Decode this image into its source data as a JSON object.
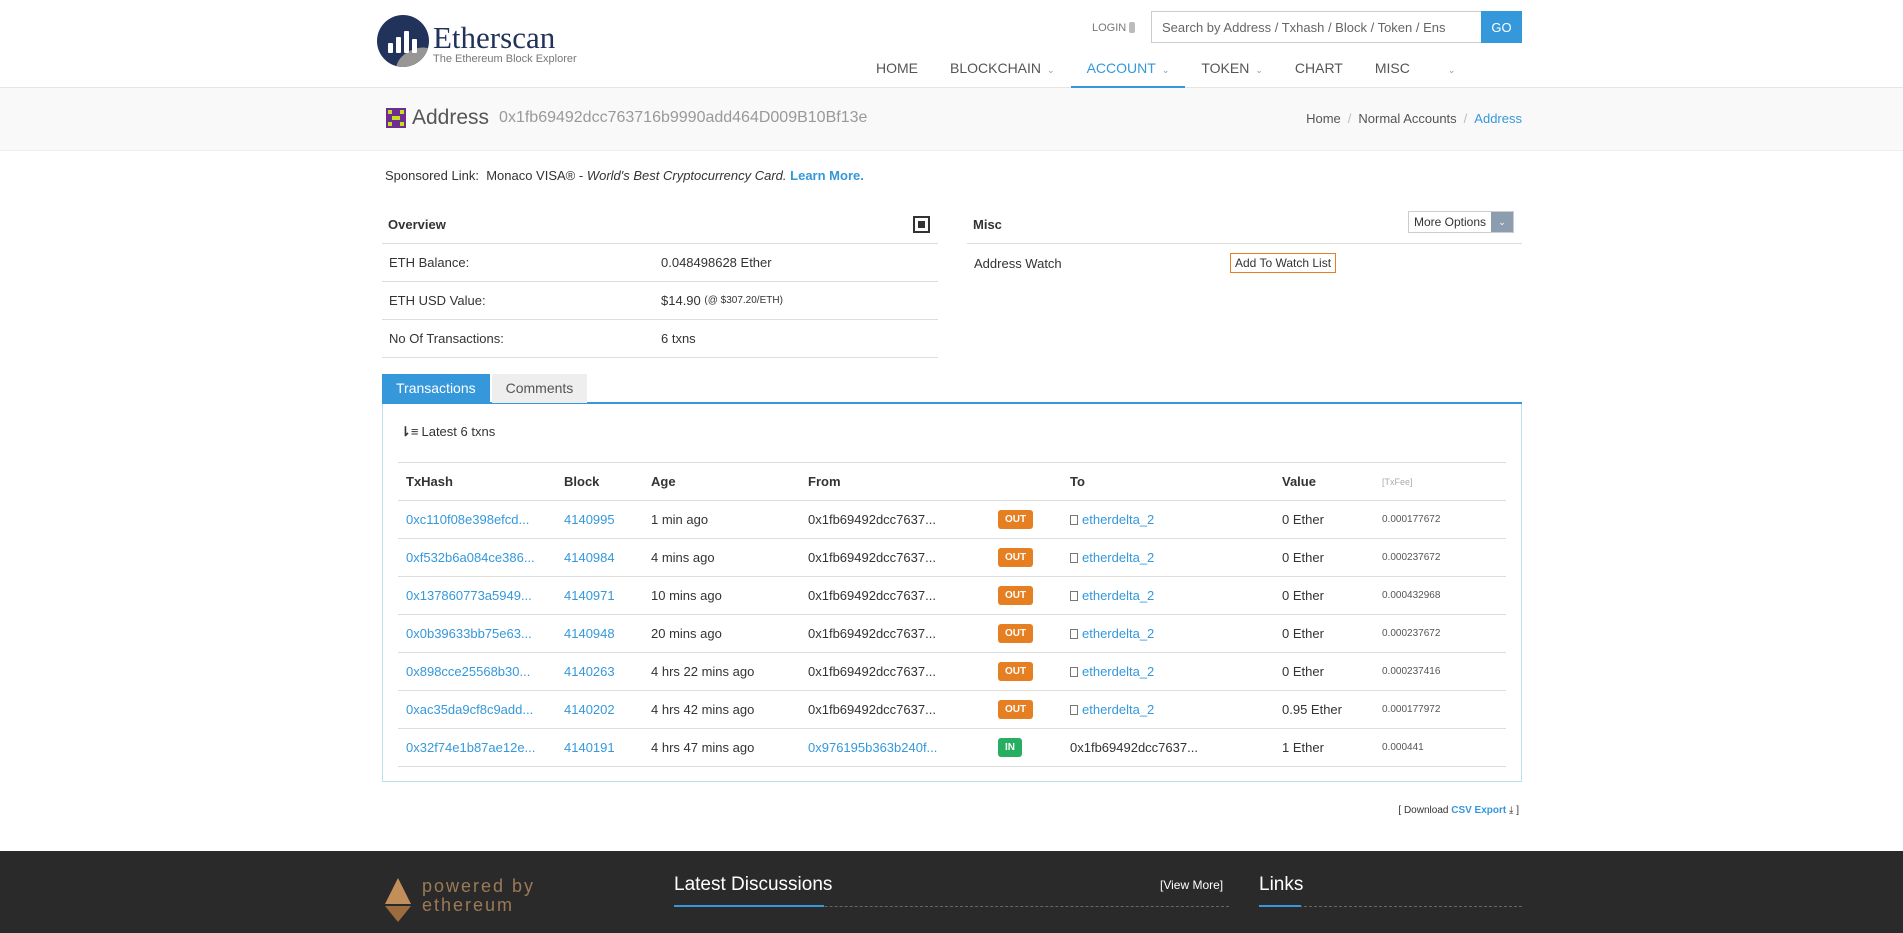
{
  "brand": {
    "name": "Etherscan",
    "tagline": "The Ethereum Block Explorer"
  },
  "header": {
    "login_label": "LOGIN",
    "search_placeholder": "Search by Address / Txhash / Block / Token / Ens",
    "search_button": "GO",
    "nav": [
      {
        "label": "HOME",
        "chevron": false,
        "active": false
      },
      {
        "label": "BLOCKCHAIN",
        "chevron": true,
        "active": false
      },
      {
        "label": "ACCOUNT",
        "chevron": true,
        "active": true
      },
      {
        "label": "TOKEN",
        "chevron": true,
        "active": false
      },
      {
        "label": "CHART",
        "chevron": false,
        "active": false
      },
      {
        "label": "MISC",
        "chevron": false,
        "active": false
      }
    ],
    "nav_extra_chevron": "⌄"
  },
  "page": {
    "title": "Address",
    "address": "0x1fb69492dcc763716b9990add464D009B10Bf13e",
    "breadcrumb": [
      "Home",
      "Normal Accounts",
      "Address"
    ]
  },
  "sponsor": {
    "prefix": "Sponsored Link:",
    "name": "Monaco VISA® - ",
    "tagline": "World's Best Cryptocurrency Card.",
    "cta": "Learn More."
  },
  "overview": {
    "title": "Overview",
    "balance_label": "ETH Balance:",
    "balance_value": "0.048498628 Ether",
    "usd_label": "ETH USD Value:",
    "usd_value": "$14.90",
    "usd_rate": "(@ $307.20/ETH)",
    "txcount_label": "No Of Transactions:",
    "txcount_value": "6 txns"
  },
  "misc": {
    "title": "Misc",
    "more_options": "More Options",
    "watch_label": "Address Watch",
    "watch_button": "Add To Watch List"
  },
  "tabs": [
    "Transactions",
    "Comments"
  ],
  "transactions": {
    "summary": "Latest 6 txns",
    "columns": [
      "TxHash",
      "Block",
      "Age",
      "From",
      "",
      "To",
      "Value",
      "[TxFee]"
    ],
    "rows": [
      {
        "hash": "0xc110f08e398efcd...",
        "block": "4140995",
        "age": "1 min ago",
        "from": "0x1fb69492dcc7637...",
        "from_link": false,
        "dir": "OUT",
        "to": "etherdelta_2",
        "to_contract": true,
        "value": "0 Ether",
        "fee": "0.000177672"
      },
      {
        "hash": "0xf532b6a084ce386...",
        "block": "4140984",
        "age": "4 mins ago",
        "from": "0x1fb69492dcc7637...",
        "from_link": false,
        "dir": "OUT",
        "to": "etherdelta_2",
        "to_contract": true,
        "value": "0 Ether",
        "fee": "0.000237672"
      },
      {
        "hash": "0x137860773a5949...",
        "block": "4140971",
        "age": "10 mins ago",
        "from": "0x1fb69492dcc7637...",
        "from_link": false,
        "dir": "OUT",
        "to": "etherdelta_2",
        "to_contract": true,
        "value": "0 Ether",
        "fee": "0.000432968"
      },
      {
        "hash": "0x0b39633bb75e63...",
        "block": "4140948",
        "age": "20 mins ago",
        "from": "0x1fb69492dcc7637...",
        "from_link": false,
        "dir": "OUT",
        "to": "etherdelta_2",
        "to_contract": true,
        "value": "0 Ether",
        "fee": "0.000237672"
      },
      {
        "hash": "0x898cce25568b30...",
        "block": "4140263",
        "age": "4 hrs 22 mins ago",
        "from": "0x1fb69492dcc7637...",
        "from_link": false,
        "dir": "OUT",
        "to": "etherdelta_2",
        "to_contract": true,
        "value": "0 Ether",
        "fee": "0.000237416"
      },
      {
        "hash": "0xac35da9cf8c9add...",
        "block": "4140202",
        "age": "4 hrs 42 mins ago",
        "from": "0x1fb69492dcc7637...",
        "from_link": false,
        "dir": "OUT",
        "to": "etherdelta_2",
        "to_contract": true,
        "value": "0.95 Ether",
        "fee": "0.000177972"
      },
      {
        "hash": "0x32f74e1b87ae12e...",
        "block": "4140191",
        "age": "4 hrs 47 mins ago",
        "from": "0x976195b363b240f...",
        "from_link": true,
        "dir": "IN",
        "to": "0x1fb69492dcc7637...",
        "to_contract": false,
        "value": "1 Ether",
        "fee": "0.000441"
      }
    ]
  },
  "csv": {
    "prefix": "[ Download ",
    "link": "CSV Export",
    "suffix": " ]"
  },
  "footer": {
    "powered_line1": "powered by",
    "powered_line2": "ethereum",
    "discussions_title": "Latest Discussions",
    "view_more": "[View More]",
    "links_title": "Links"
  },
  "colors": {
    "accent": "#3498db",
    "out": "#e67e22",
    "in": "#27ae60",
    "brand": "#21325b"
  }
}
